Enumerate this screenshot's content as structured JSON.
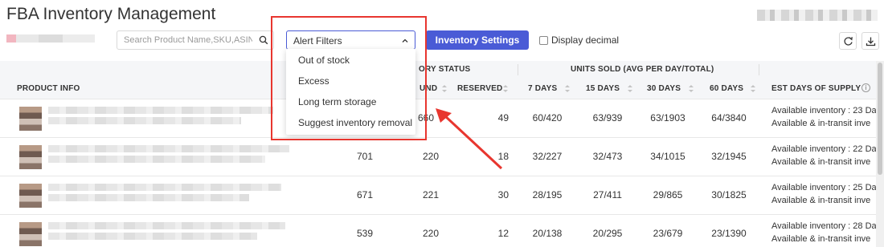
{
  "page": {
    "title": "FBA Inventory Management"
  },
  "toolbar": {
    "search_placeholder": "Search Product Name,SKU,ASIN",
    "alert_filter": {
      "value": "Alert Filters",
      "options": [
        "Out of stock",
        "Excess",
        "Long term storage",
        "Suggest inventory removal"
      ]
    },
    "settings_label": "Inventory Settings",
    "decimal_label": "Display decimal"
  },
  "table": {
    "group_headers": {
      "inventory_status": "ORY STATUS",
      "units_sold": "UNITS SOLD (AVG PER DAY/TOTAL)"
    },
    "columns": {
      "product_info": "PRODUCT INFO",
      "on_hand": "UND",
      "reserved": "RESERVED",
      "d7": "7 DAYS",
      "d15": "15 DAYS",
      "d30": "30 DAYS",
      "d60": "60 DAYS",
      "supply": "EST DAYS OF SUPPLY"
    },
    "rows": [
      {
        "qty": "",
        "on_hand": "660",
        "reserved": "49",
        "d7": "60/420",
        "d15": "63/939",
        "d30": "63/1903",
        "d60": "64/3840",
        "supply1": "Available inventory : 23 Da",
        "supply2": "Available & in-transit inve"
      },
      {
        "qty": "701",
        "on_hand": "220",
        "reserved": "18",
        "d7": "32/227",
        "d15": "32/473",
        "d30": "34/1015",
        "d60": "32/1945",
        "supply1": "Available inventory : 22 Da",
        "supply2": "Available & in-transit inve"
      },
      {
        "qty": "671",
        "on_hand": "221",
        "reserved": "30",
        "d7": "28/195",
        "d15": "27/411",
        "d30": "29/865",
        "d60": "30/1825",
        "supply1": "Available inventory : 25 Da",
        "supply2": "Available & in-transit inve"
      },
      {
        "qty": "539",
        "on_hand": "220",
        "reserved": "12",
        "d7": "20/138",
        "d15": "20/295",
        "d30": "23/679",
        "d60": "23/1390",
        "supply1": "Available inventory : 28 Da",
        "supply2": "Available & in-transit inve"
      }
    ]
  },
  "colors": {
    "accent": "#4a5bd6",
    "highlight": "#e8362f"
  },
  "icons": [
    "search-icon",
    "chevron-up-icon",
    "refresh-icon",
    "download-icon",
    "info-icon",
    "sort-icon",
    "arrow-annotation-icon"
  ]
}
